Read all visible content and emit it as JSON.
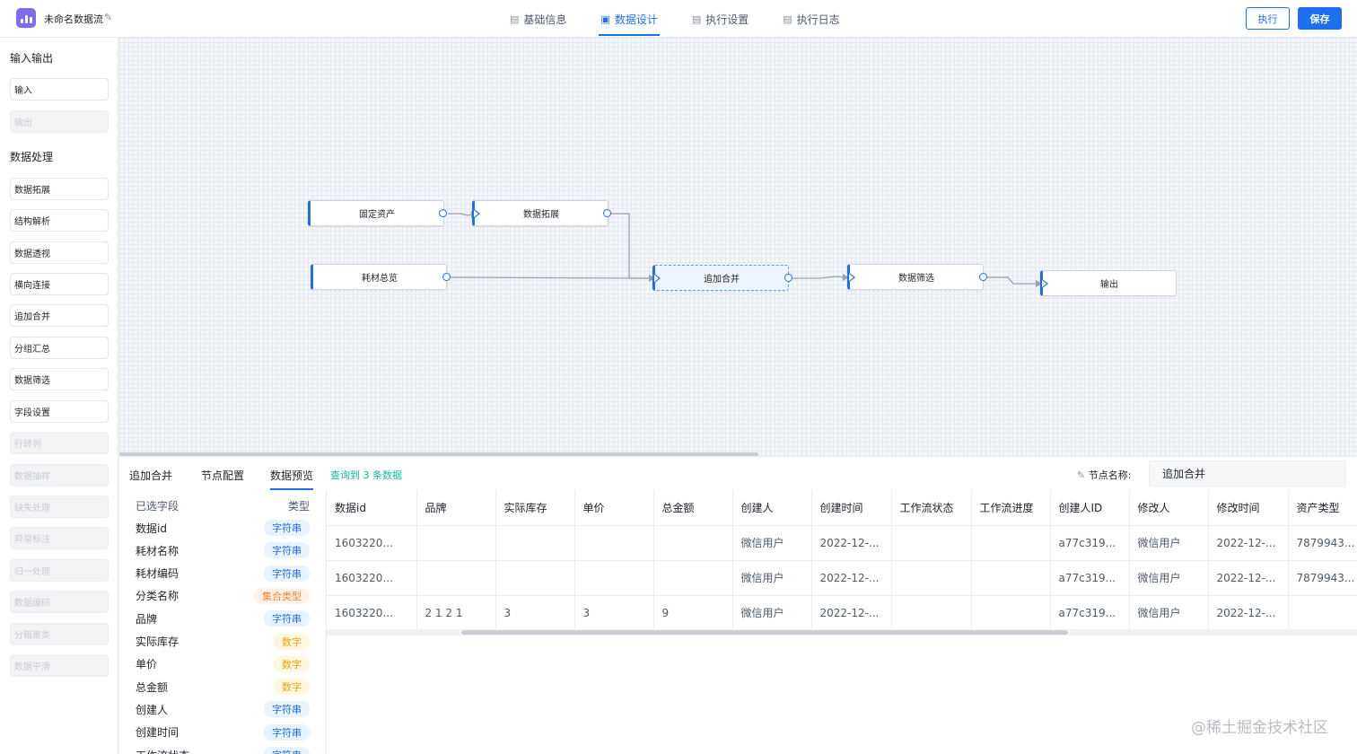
{
  "header": {
    "app_title": "未命名数据流",
    "tabs": [
      {
        "label": "基础信息",
        "icon": "doc-icon",
        "active": false
      },
      {
        "label": "数据设计",
        "icon": "design-icon",
        "active": true
      },
      {
        "label": "执行设置",
        "icon": "doc-icon",
        "active": false
      },
      {
        "label": "执行日志",
        "icon": "doc-icon",
        "active": false
      }
    ],
    "run_label": "执行",
    "save_label": "保存"
  },
  "sidebar": {
    "io_title": "输入输出",
    "io_items": [
      {
        "label": "输入",
        "disabled": false
      },
      {
        "label": "输出",
        "disabled": true
      }
    ],
    "proc_title": "数据处理",
    "proc_items": [
      {
        "label": "数据拓展",
        "disabled": false
      },
      {
        "label": "结构解析",
        "disabled": false
      },
      {
        "label": "数据透视",
        "disabled": false
      },
      {
        "label": "横向连接",
        "disabled": false
      },
      {
        "label": "追加合并",
        "disabled": false
      },
      {
        "label": "分组汇总",
        "disabled": false
      },
      {
        "label": "数据筛选",
        "disabled": false
      },
      {
        "label": "字段设置",
        "disabled": false
      },
      {
        "label": "行转列",
        "disabled": true
      },
      {
        "label": "数据抽样",
        "disabled": true
      },
      {
        "label": "缺失处理",
        "disabled": true
      },
      {
        "label": "异常标注",
        "disabled": true
      },
      {
        "label": "归一处理",
        "disabled": true
      },
      {
        "label": "数据编码",
        "disabled": true
      },
      {
        "label": "分箱聚类",
        "disabled": true
      },
      {
        "label": "数据平滑",
        "disabled": true
      }
    ]
  },
  "canvas": {
    "nodes": {
      "fixed_assets": "固定资产",
      "data_expand": "数据拓展",
      "consumables": "耗材总览",
      "append_merge": "追加合并",
      "data_filter": "数据筛选",
      "output": "输出"
    }
  },
  "bottom": {
    "tabs": [
      "追加合并",
      "节点配置",
      "数据预览"
    ],
    "active_tab": "数据预览",
    "query_info": "查询到 3 条数据",
    "node_name_label": "节点名称:",
    "node_name_value": "追加合并",
    "fields_header": {
      "name": "已选字段",
      "type": "类型"
    },
    "fields": [
      {
        "name": "数据id",
        "type": "字符串",
        "kind": "str"
      },
      {
        "name": "耗材名称",
        "type": "字符串",
        "kind": "str"
      },
      {
        "name": "耗材编码",
        "type": "字符串",
        "kind": "str"
      },
      {
        "name": "分类名称",
        "type": "集合类型",
        "kind": "set"
      },
      {
        "name": "品牌",
        "type": "字符串",
        "kind": "str"
      },
      {
        "name": "实际库存",
        "type": "数字",
        "kind": "num"
      },
      {
        "name": "单价",
        "type": "数字",
        "kind": "num"
      },
      {
        "name": "总金额",
        "type": "数字",
        "kind": "num"
      },
      {
        "name": "创建人",
        "type": "字符串",
        "kind": "str"
      },
      {
        "name": "创建时间",
        "type": "字符串",
        "kind": "str"
      },
      {
        "name": "工作流状态",
        "type": "字符串",
        "kind": "str"
      }
    ],
    "table": {
      "columns": [
        "数据id",
        "品牌",
        "实际库存",
        "单价",
        "总金额",
        "创建人",
        "创建时间",
        "工作流状态",
        "工作流进度",
        "创建人ID",
        "修改人",
        "修改时间",
        "资产类型"
      ],
      "rows": [
        [
          "1603220...",
          "",
          "",
          "",
          "",
          "微信用户",
          "2022-12-...",
          "",
          "",
          "a77c319...",
          "微信用户",
          "2022-12-...",
          "7879943..."
        ],
        [
          "1603220...",
          "",
          "",
          "",
          "",
          "微信用户",
          "2022-12-...",
          "",
          "",
          "a77c319...",
          "微信用户",
          "2022-12-...",
          "7879943..."
        ],
        [
          "1603220...",
          "2 1 2 1",
          "3",
          "3",
          "9",
          "微信用户",
          "2022-12-...",
          "",
          "",
          "a77c319...",
          "微信用户",
          "2022-12-...",
          ""
        ]
      ]
    }
  },
  "watermark": "@稀土掘金技术社区",
  "colors": {
    "primary": "#1d6ff2",
    "logo": "#7c6cf0",
    "success_text": "#0fbf9f"
  }
}
